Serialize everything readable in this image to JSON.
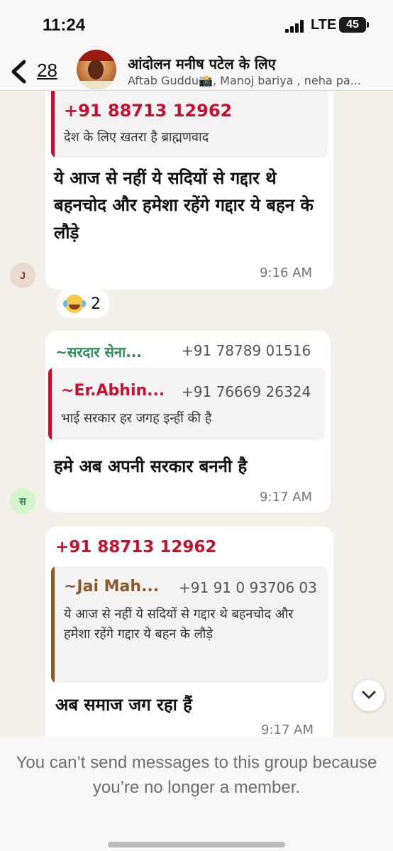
{
  "status_bar": {
    "time": "11:24",
    "network": "LTE",
    "battery": "45"
  },
  "header": {
    "back_count": "28",
    "title": "आंदोलन मनीष पटेल के लिए",
    "members": "Aftab Guddu📸, Manoj bariya , neha pa..."
  },
  "colors": {
    "red_sender": "#c8102e",
    "green_sender": "#2e8b57",
    "brown_quote": "#8a5a2b",
    "avatar_j_bg": "#ead9cf",
    "avatar_s_bg": "#d3f5c8"
  },
  "messages": [
    {
      "quote": {
        "name": "+91 88713 12962",
        "text": "देश के लिए खतरा है ब्राह्मणवाद"
      },
      "text": "ये आज से नहीं ये सदियों से गद्दार थे बहनचोद और हमेशा रहेंगे गद्दार ये बहन के लौड़े",
      "time": "9:16 AM",
      "avatar": "J",
      "reaction": {
        "emoji": "face-with-tears-of-joy",
        "count": "2"
      }
    },
    {
      "sender": "~सरदार सेना...",
      "sender_phone": "+91 78789 01516",
      "quote": {
        "name": "~Er.Abhin...",
        "phone": "+91 76669 26324",
        "text": "भाई सरकार हर जगह इन्हीं की है"
      },
      "text": "हमे अब अपनी सरकार बननी है",
      "time": "9:17 AM",
      "avatar": "स"
    },
    {
      "sender": "+91 88713 12962",
      "quote": {
        "name": "~Jai Mah...",
        "phone": "+91 91 0 93706 03",
        "text": "ये आज से नहीं ये सदियों से गद्दार थे बहनचोद और हमेशा रहेंगे गद्दार ये बहन के लौड़े"
      },
      "text": "अब समाज जग रहा हैं",
      "time": "9:17 AM"
    }
  ],
  "footer": {
    "notice": "You can’t send messages to this group because you’re no longer a member."
  }
}
